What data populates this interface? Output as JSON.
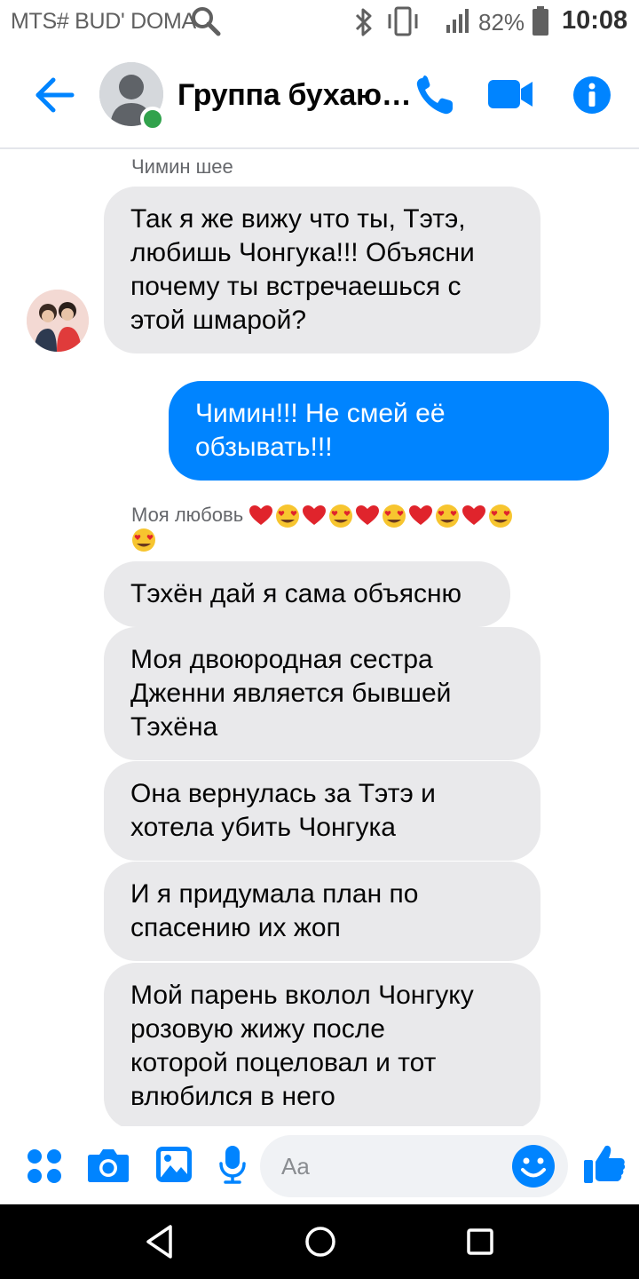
{
  "status_bar": {
    "carrier": "MTS# BUD' DOMA",
    "battery_percent": "82%",
    "time": "10:08",
    "icons": [
      "search-icon",
      "bluetooth-icon",
      "vibrate-icon",
      "signal-icon",
      "battery-icon"
    ]
  },
  "header": {
    "title": "Группа бухаю…",
    "online": true,
    "icons": [
      "back-arrow-icon",
      "phone-icon",
      "video-icon",
      "info-icon"
    ]
  },
  "messages": [
    {
      "sender": "Чимин шее",
      "direction": "incoming",
      "text_lines": [
        "Так я же вижу что ты, Тэтэ,",
        "любишь Чонгука!!! Объясни",
        "почему ты встречаешься с",
        "этой шмарой?"
      ]
    },
    {
      "direction": "outgoing",
      "text_lines": [
        "Чимин!!! Не смей её",
        "обзывать!!!"
      ]
    },
    {
      "sender": "Моя любовь",
      "direction": "incoming",
      "text_lines": [
        "Тэхён дай я сама объясню"
      ]
    },
    {
      "direction": "incoming",
      "text_lines": [
        "Моя двоюродная сестра",
        "Дженни является бывшей",
        "Тэхёна"
      ]
    },
    {
      "direction": "incoming",
      "text_lines": [
        "Она вернулась за Тэтэ и",
        "хотела убить Чонгука"
      ]
    },
    {
      "direction": "incoming",
      "text_lines": [
        "И я придумала план по",
        "спасению их жоп"
      ]
    },
    {
      "direction": "incoming",
      "text_lines": [
        "Мой парень вколол Чонгуку",
        "розовую жижу после",
        "которой поцеловал и тот",
        "влюбился в него"
      ]
    }
  ],
  "composer": {
    "placeholder": "Aa",
    "icons": [
      "apps-icon",
      "camera-icon",
      "gallery-icon",
      "microphone-icon",
      "emoji-icon",
      "like-icon"
    ]
  },
  "nav": {
    "icons": [
      "back-triangle-icon",
      "home-circle-icon",
      "recents-square-icon"
    ]
  },
  "colors": {
    "accent": "#0084ff",
    "incoming_bubble": "#e9e9eb",
    "online": "#31a24c"
  }
}
